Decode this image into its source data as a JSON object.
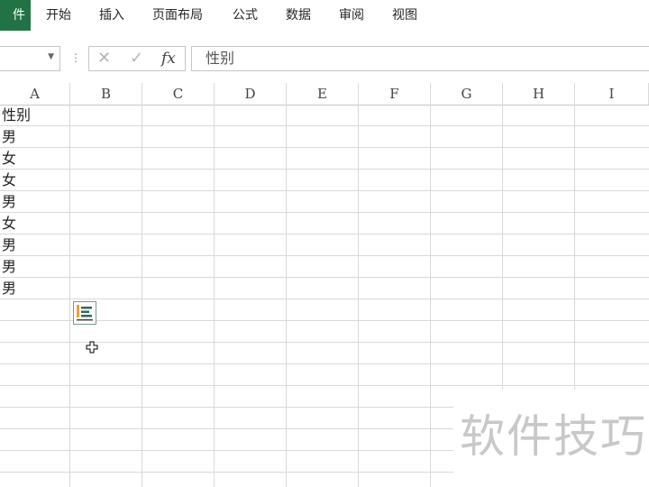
{
  "ribbon": {
    "tabs": [
      "件",
      "开始",
      "插入",
      "页面布局",
      "公式",
      "数据",
      "审阅",
      "视图"
    ],
    "accent": "#217346"
  },
  "formula_bar": {
    "name_box_value": "",
    "cancel_icon": "close-icon",
    "enter_icon": "check-icon",
    "fx_label": "fx",
    "content": "性别"
  },
  "grid": {
    "columns": [
      "A",
      "B",
      "C",
      "D",
      "E",
      "F",
      "G",
      "H",
      "I"
    ],
    "column_a_values": [
      "性别",
      "男",
      "女",
      "女",
      "男",
      "女",
      "男",
      "男",
      "男"
    ]
  },
  "watermark": "软件技巧"
}
